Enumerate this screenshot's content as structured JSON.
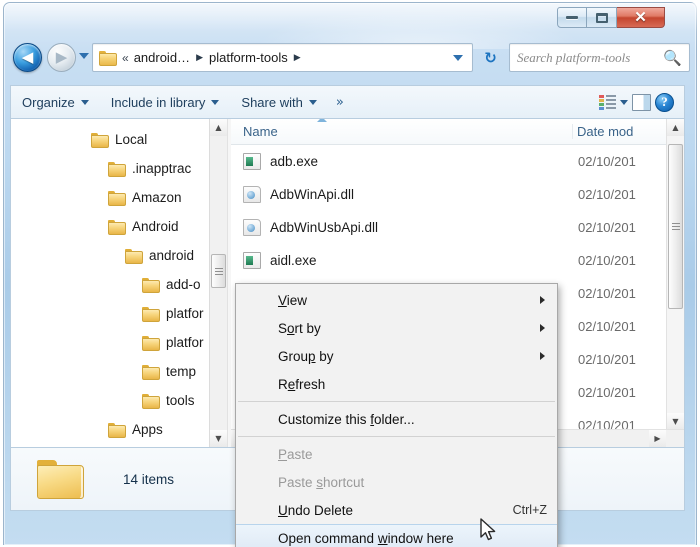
{
  "window": {
    "controls": {
      "minimize_label": "Minimize",
      "maximize_label": "Maximize",
      "close_label": "✕"
    }
  },
  "navbar": {
    "back_label": "◀",
    "forward_label": "▶",
    "history_dropdown_label": "Recent pages",
    "breadcrumb": {
      "folder_icon": "folder-icon",
      "overflow": "«",
      "items": [
        {
          "label": "android…",
          "arrow": "▶"
        },
        {
          "label": "platform-tools",
          "arrow": "▶"
        }
      ],
      "dropdown_label": "Previous locations"
    },
    "refresh_label": "↻",
    "search": {
      "placeholder": "Search platform-tools",
      "value": "",
      "icon": "search-icon"
    }
  },
  "toolbar": {
    "buttons": [
      {
        "label": "Organize",
        "has_caret": true
      },
      {
        "label": "Include in library",
        "has_caret": true
      },
      {
        "label": "Share with",
        "has_caret": true
      }
    ],
    "overflow_label": "»",
    "views_label": "Change your view",
    "preview_pane_label": "Show the preview pane",
    "help_label": "?"
  },
  "navpane": {
    "tree": [
      {
        "label": "Local",
        "indent": 80
      },
      {
        "label": ".inapptrac",
        "indent": 97
      },
      {
        "label": "Amazon",
        "indent": 97
      },
      {
        "label": "Android",
        "indent": 97
      },
      {
        "label": "android",
        "indent": 114
      },
      {
        "label": "add-o",
        "indent": 131
      },
      {
        "label": "platfor",
        "indent": 131
      },
      {
        "label": "platfor",
        "indent": 131
      },
      {
        "label": "temp",
        "indent": 131
      },
      {
        "label": "tools",
        "indent": 131
      },
      {
        "label": "Apps",
        "indent": 97
      }
    ],
    "scroll_up_label": "▲",
    "scroll_down_label": "▼"
  },
  "filelist": {
    "columns": [
      {
        "label": "Name",
        "key": "name"
      },
      {
        "label": "Date mod",
        "key": "date"
      }
    ],
    "sort_column": "Name",
    "sort_direction": "ascending",
    "rows": [
      {
        "name": "adb.exe",
        "date": "02/10/201",
        "icon": "exe-file-icon"
      },
      {
        "name": "AdbWinApi.dll",
        "date": "02/10/201",
        "icon": "dll-file-icon"
      },
      {
        "name": "AdbWinUsbApi.dll",
        "date": "02/10/201",
        "icon": "dll-file-icon"
      },
      {
        "name": "aidl.exe",
        "date": "02/10/201",
        "icon": "exe-file-icon"
      },
      {
        "name": "",
        "date": "02/10/201",
        "icon": ""
      },
      {
        "name": "",
        "date": "02/10/201",
        "icon": ""
      },
      {
        "name": "",
        "date": "02/10/201",
        "icon": ""
      },
      {
        "name": "",
        "date": "02/10/201",
        "icon": ""
      },
      {
        "name": "",
        "date": "02/10/201",
        "icon": ""
      }
    ],
    "scroll_up_label": "▲",
    "scroll_down_label": "▼",
    "scroll_left_label": "◀",
    "scroll_right_label": "▶"
  },
  "statusbar": {
    "item_count": "14 items",
    "folder_icon": "folder-icon"
  },
  "contextmenu": {
    "items": [
      {
        "label": "View",
        "submenu": true,
        "disabled": false,
        "accel": "",
        "highlight": false
      },
      {
        "label": "Sort by",
        "submenu": true,
        "disabled": false,
        "accel": "",
        "highlight": false
      },
      {
        "label": "Group by",
        "submenu": true,
        "disabled": false,
        "accel": "",
        "highlight": false
      },
      {
        "label": "Refresh",
        "submenu": false,
        "disabled": false,
        "accel": "",
        "highlight": false
      },
      {
        "separator": true
      },
      {
        "label": "Customize this folder...",
        "submenu": false,
        "disabled": false,
        "accel": "",
        "highlight": false
      },
      {
        "separator": true
      },
      {
        "label": "Paste",
        "submenu": false,
        "disabled": true,
        "accel": "",
        "highlight": false
      },
      {
        "label": "Paste shortcut",
        "submenu": false,
        "disabled": true,
        "accel": "",
        "highlight": false
      },
      {
        "label": "Undo Delete",
        "submenu": false,
        "disabled": false,
        "accel": "Ctrl+Z",
        "highlight": false
      },
      {
        "label": "Open command window here",
        "submenu": false,
        "disabled": false,
        "accel": "",
        "highlight": true
      }
    ]
  },
  "colors": {
    "accent": "#1d6fb8",
    "close_button": "#c4452f",
    "highlight": "#dfeaf6",
    "folder_yellow": "#f7d57d"
  }
}
